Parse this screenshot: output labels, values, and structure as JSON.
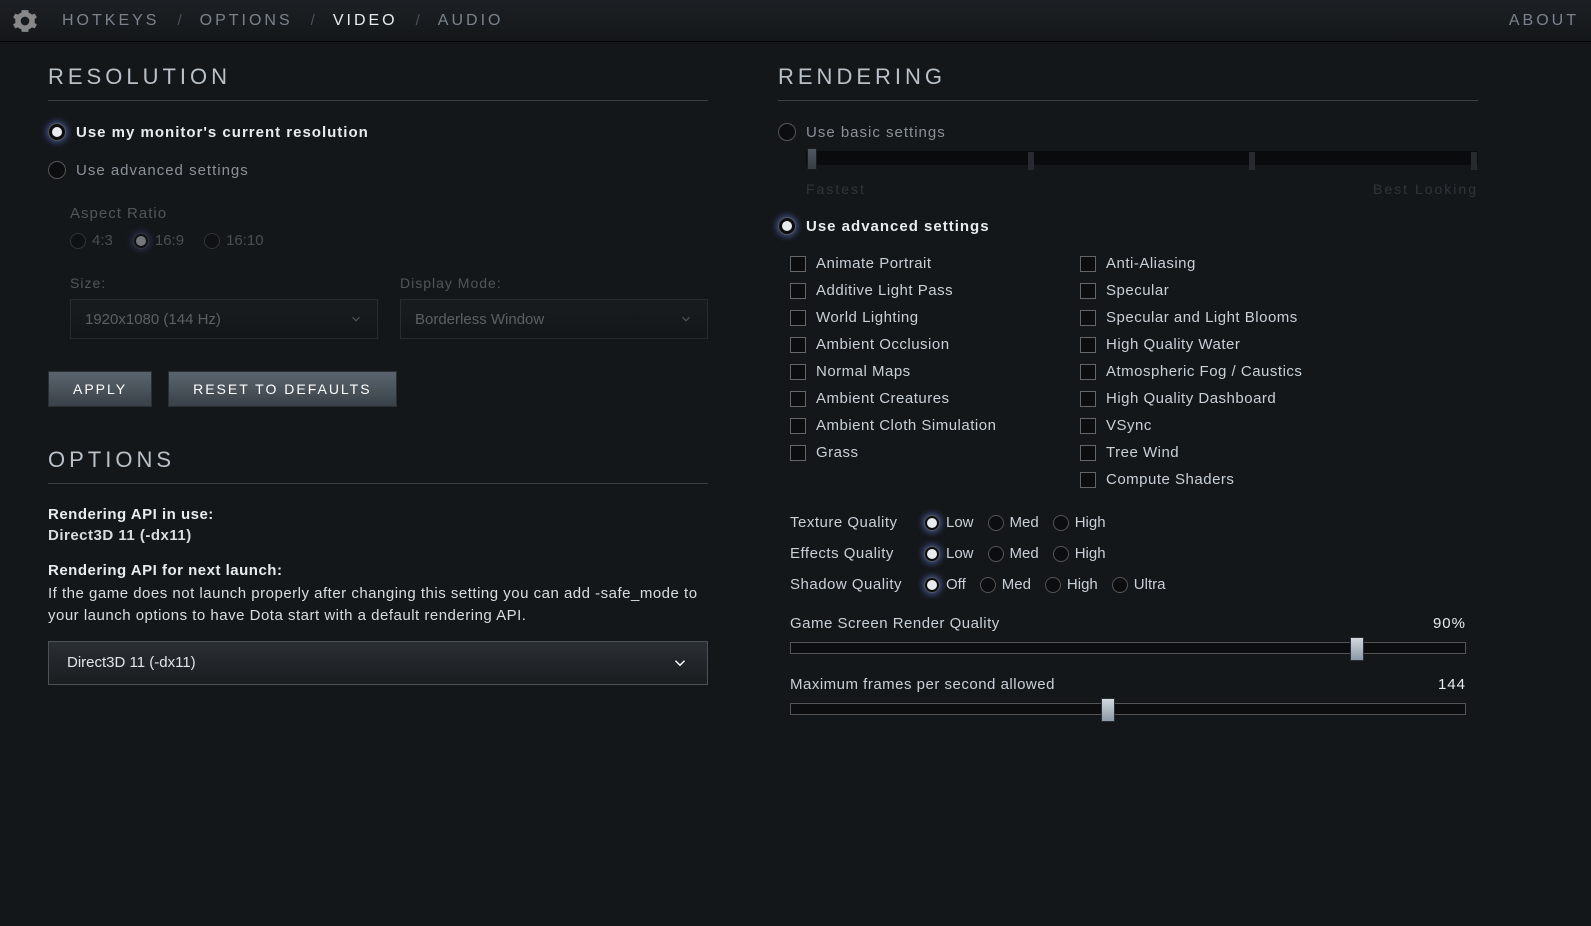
{
  "tabs": {
    "hotkeys": "HOTKEYS",
    "options": "OPTIONS",
    "video": "VIDEO",
    "audio": "AUDIO",
    "about": "ABOUT"
  },
  "resolution": {
    "title": "RESOLUTION",
    "use_monitor": "Use my monitor's current resolution",
    "use_advanced": "Use advanced settings",
    "aspect_ratio_label": "Aspect Ratio",
    "ratios": {
      "r43": "4:3",
      "r169": "16:9",
      "r1610": "16:10"
    },
    "size_label": "Size:",
    "size_value": "1920x1080 (144 Hz)",
    "display_mode_label": "Display Mode:",
    "display_mode_value": "Borderless Window",
    "apply": "APPLY",
    "reset": "RESET TO DEFAULTS"
  },
  "options": {
    "title": "OPTIONS",
    "api_in_use_label": "Rendering API in use:",
    "api_in_use_value": "Direct3D 11 (-dx11)",
    "api_next_label": "Rendering API for next launch:",
    "api_next_desc": "If the game does not launch properly after changing this setting you can add -safe_mode to your launch options to have Dota start with a default rendering API.",
    "api_select_value": "Direct3D 11 (-dx11)"
  },
  "rendering": {
    "title": "RENDERING",
    "use_basic": "Use basic settings",
    "basic_fastest": "Fastest",
    "basic_best": "Best Looking",
    "use_advanced": "Use advanced settings",
    "checks_left": [
      "Animate Portrait",
      "Additive Light Pass",
      "World Lighting",
      "Ambient Occlusion",
      "Normal Maps",
      "Ambient Creatures",
      "Ambient Cloth Simulation",
      "Grass"
    ],
    "checks_right": [
      "Anti-Aliasing",
      "Specular",
      "Specular and Light Blooms",
      "High Quality Water",
      "Atmospheric Fog / Caustics",
      "High Quality Dashboard",
      "VSync",
      "Tree Wind",
      "Compute Shaders"
    ],
    "texture_label": "Texture Quality",
    "texture_opts": [
      "Low",
      "Med",
      "High"
    ],
    "effects_label": "Effects Quality",
    "effects_opts": [
      "Low",
      "Med",
      "High"
    ],
    "shadow_label": "Shadow Quality",
    "shadow_opts": [
      "Off",
      "Med",
      "High",
      "Ultra"
    ],
    "render_quality_label": "Game Screen Render Quality",
    "render_quality_value": "90%",
    "render_quality_pct": 83,
    "fps_label": "Maximum frames per second allowed",
    "fps_value": "144",
    "fps_pct": 46
  }
}
